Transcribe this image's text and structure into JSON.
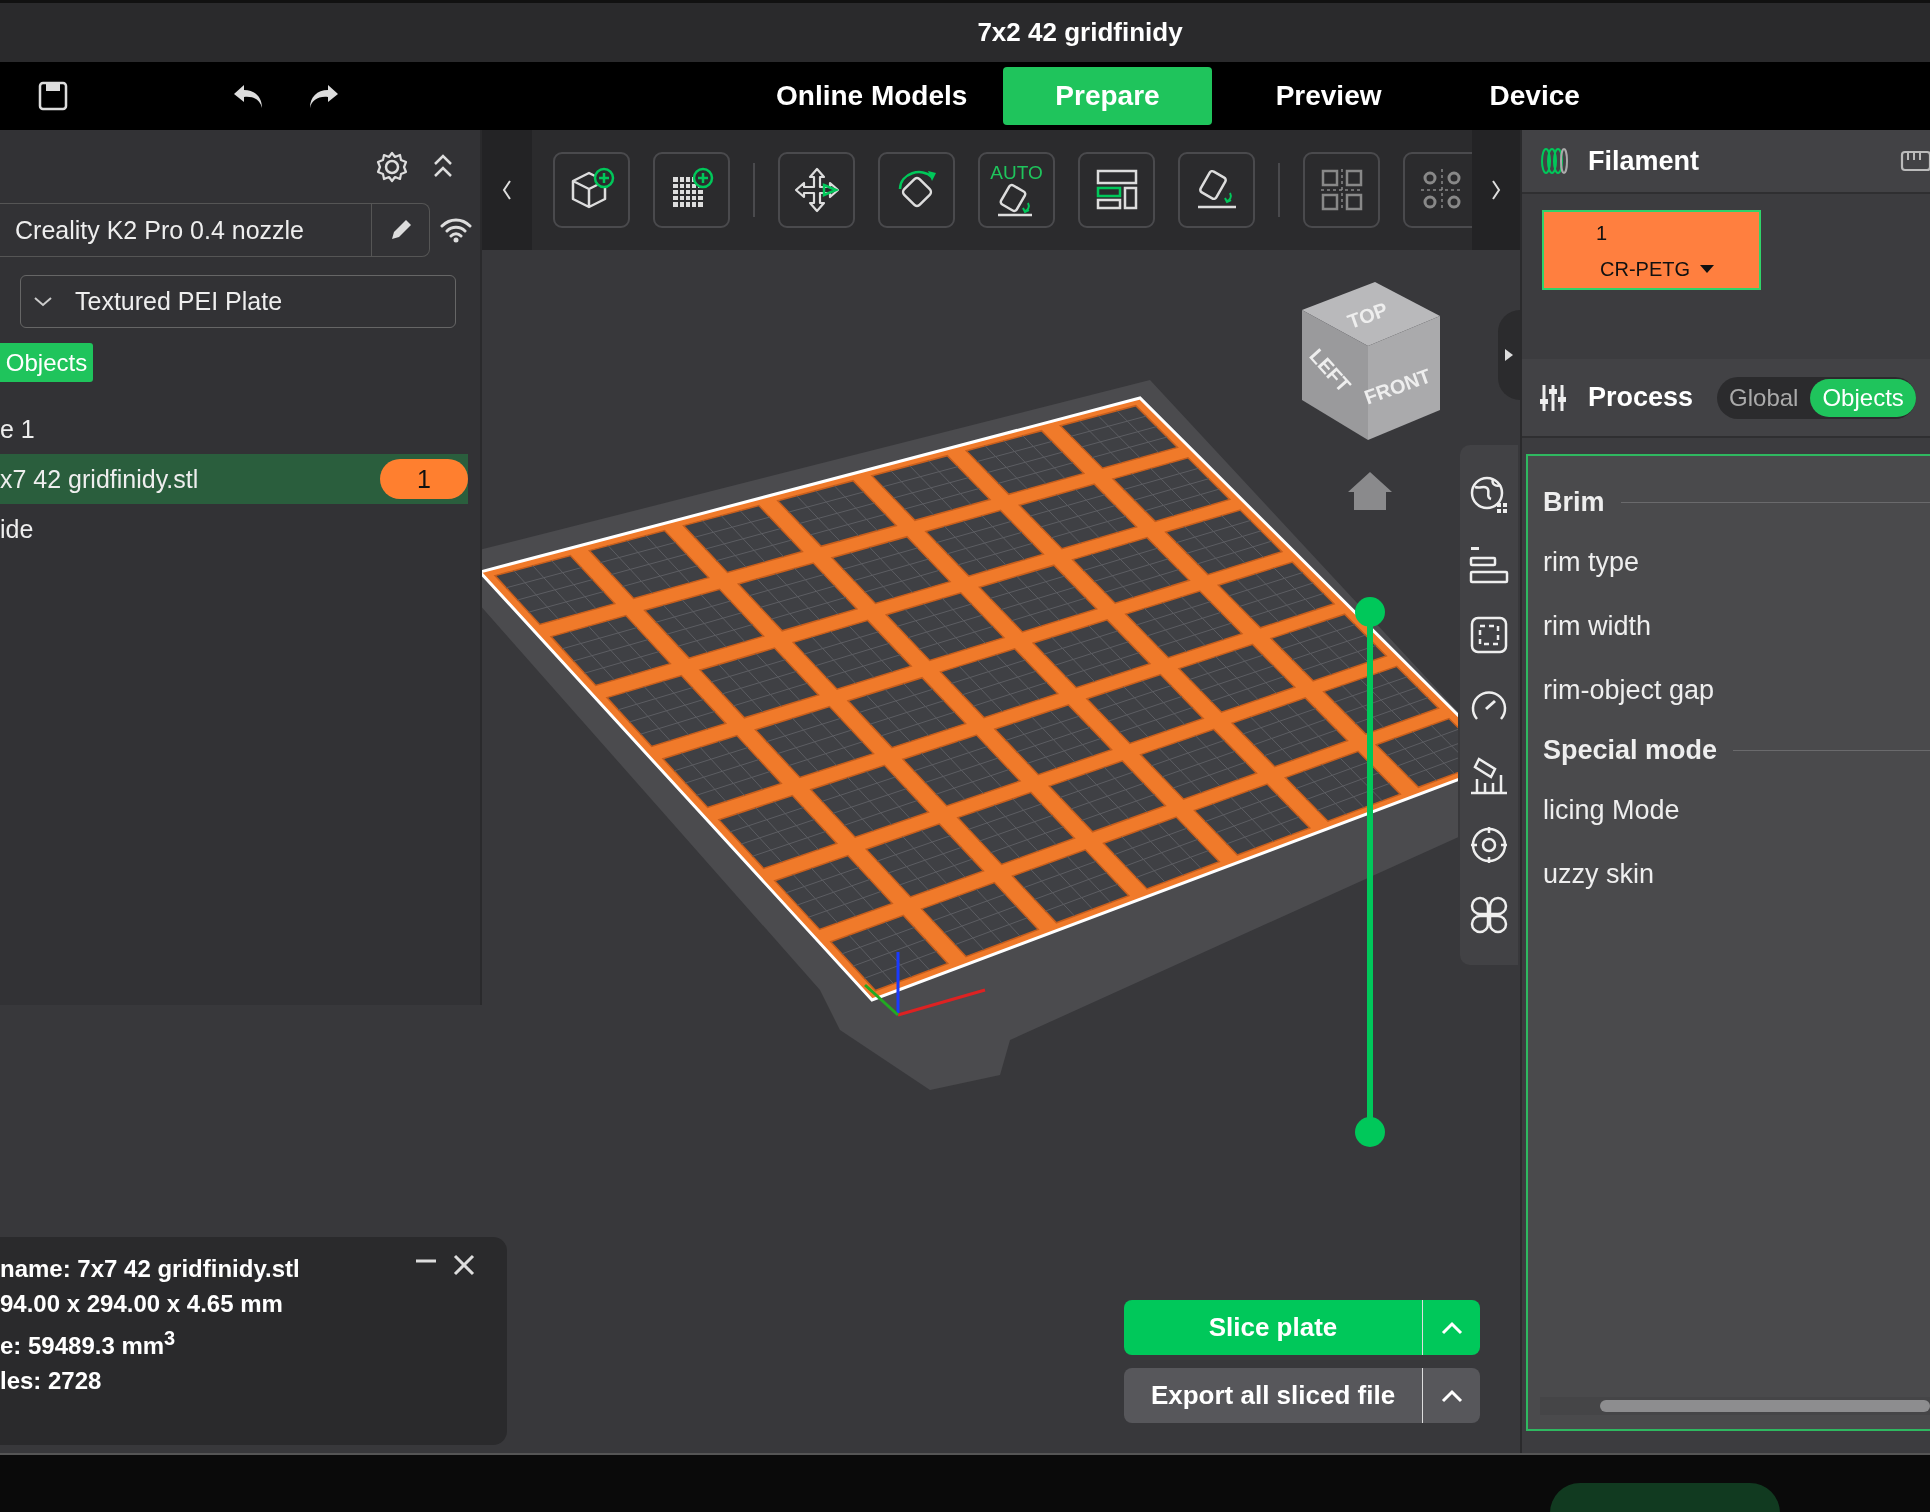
{
  "window": {
    "title": "7x2 42 gridfinidy"
  },
  "nav_tabs": [
    {
      "label": "Online Models",
      "selected": false
    },
    {
      "label": "Prepare",
      "selected": true
    },
    {
      "label": "Preview",
      "selected": false
    },
    {
      "label": "Device",
      "selected": false
    }
  ],
  "printer": {
    "name": "Creality K2 Pro 0.4 nozzle"
  },
  "plate_type": {
    "value": "Textured PEI Plate"
  },
  "objects_tab": {
    "label": "Objects"
  },
  "object_list": [
    {
      "label": "e 1",
      "selected": false
    },
    {
      "label": "x7 42 gridfinidy.stl",
      "selected": true,
      "badge": "1"
    },
    {
      "label": "ide",
      "selected": false
    }
  ],
  "toolbar": {
    "tools": [
      {
        "kind": "add-object"
      },
      {
        "kind": "add-plate"
      },
      {
        "kind": "separator"
      },
      {
        "kind": "move"
      },
      {
        "kind": "rotate"
      },
      {
        "kind": "auto-orient",
        "label": "AUTO"
      },
      {
        "kind": "arrange"
      },
      {
        "kind": "lay-flat"
      },
      {
        "kind": "separator"
      },
      {
        "kind": "split"
      },
      {
        "kind": "split-settings"
      }
    ]
  },
  "view_cube": {
    "faces": [
      "TOP",
      "LEFT",
      "FRONT"
    ]
  },
  "object_info": {
    "lines": [
      "name: 7x7 42 gridfinidy.stl",
      "94.00 x 294.00 x 4.65 mm",
      "e: 59489.3 mm$^{3}$",
      "les: 2728"
    ]
  },
  "actions": [
    {
      "label": "Slice plate",
      "kind": "primary"
    },
    {
      "label": "Export all sliced file",
      "kind": "secondary"
    }
  ],
  "filament": {
    "title": "Filament",
    "slots": [
      {
        "index": "1",
        "material": "CR-PETG",
        "color": "#ff7f3f"
      }
    ]
  },
  "process": {
    "title": "Process",
    "modes": [
      {
        "label": "Global",
        "selected": false
      },
      {
        "label": "Objects",
        "selected": true
      }
    ]
  },
  "settings": [
    {
      "kind": "section",
      "label": "Brim"
    },
    {
      "kind": "option",
      "label": "rim type"
    },
    {
      "kind": "option",
      "label": "rim width"
    },
    {
      "kind": "option",
      "label": "rim-object gap"
    },
    {
      "kind": "section",
      "label": "Special mode"
    },
    {
      "kind": "option",
      "label": "licing Mode"
    },
    {
      "kind": "option",
      "label": "uzzy skin"
    }
  ]
}
